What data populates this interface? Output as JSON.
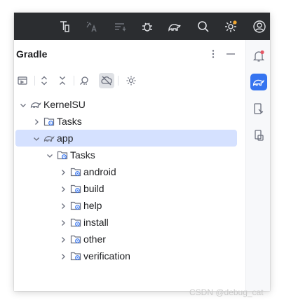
{
  "title_toolbar": {
    "icons": [
      "build-variant-icon",
      "translate-icon",
      "sync-icon",
      "debug-icon",
      "gradle-elephant-icon",
      "search-icon",
      "settings-icon",
      "account-icon"
    ],
    "settings_badge_color": "#f0a732"
  },
  "panel": {
    "title": "Gradle"
  },
  "tree": {
    "root": {
      "label": "KernelSU",
      "expanded": true
    },
    "items": [
      {
        "label": "Tasks",
        "level": 1,
        "expanded": false,
        "icon": "tasks-folder-icon"
      },
      {
        "label": "app",
        "level": 1,
        "expanded": true,
        "selected": true,
        "icon": "gradle-module-icon"
      },
      {
        "label": "Tasks",
        "level": 2,
        "expanded": true,
        "icon": "tasks-folder-icon"
      },
      {
        "label": "android",
        "level": 3,
        "expanded": false,
        "icon": "tasks-folder-icon"
      },
      {
        "label": "build",
        "level": 3,
        "expanded": false,
        "icon": "tasks-folder-icon"
      },
      {
        "label": "help",
        "level": 3,
        "expanded": false,
        "icon": "tasks-folder-icon"
      },
      {
        "label": "install",
        "level": 3,
        "expanded": false,
        "icon": "tasks-folder-icon"
      },
      {
        "label": "other",
        "level": 3,
        "expanded": false,
        "icon": "tasks-folder-icon"
      },
      {
        "label": "verification",
        "level": 3,
        "expanded": false,
        "icon": "tasks-folder-icon"
      }
    ]
  },
  "side_stripe": {
    "buttons": [
      "notifications-icon",
      "gradle-tool-window-icon",
      "device-manager-icon",
      "running-devices-icon"
    ],
    "active": "gradle-tool-window-icon",
    "accent": "#3574f0",
    "notification_badge_color": "#e55765"
  },
  "watermark": "CSDN @debug_cat"
}
